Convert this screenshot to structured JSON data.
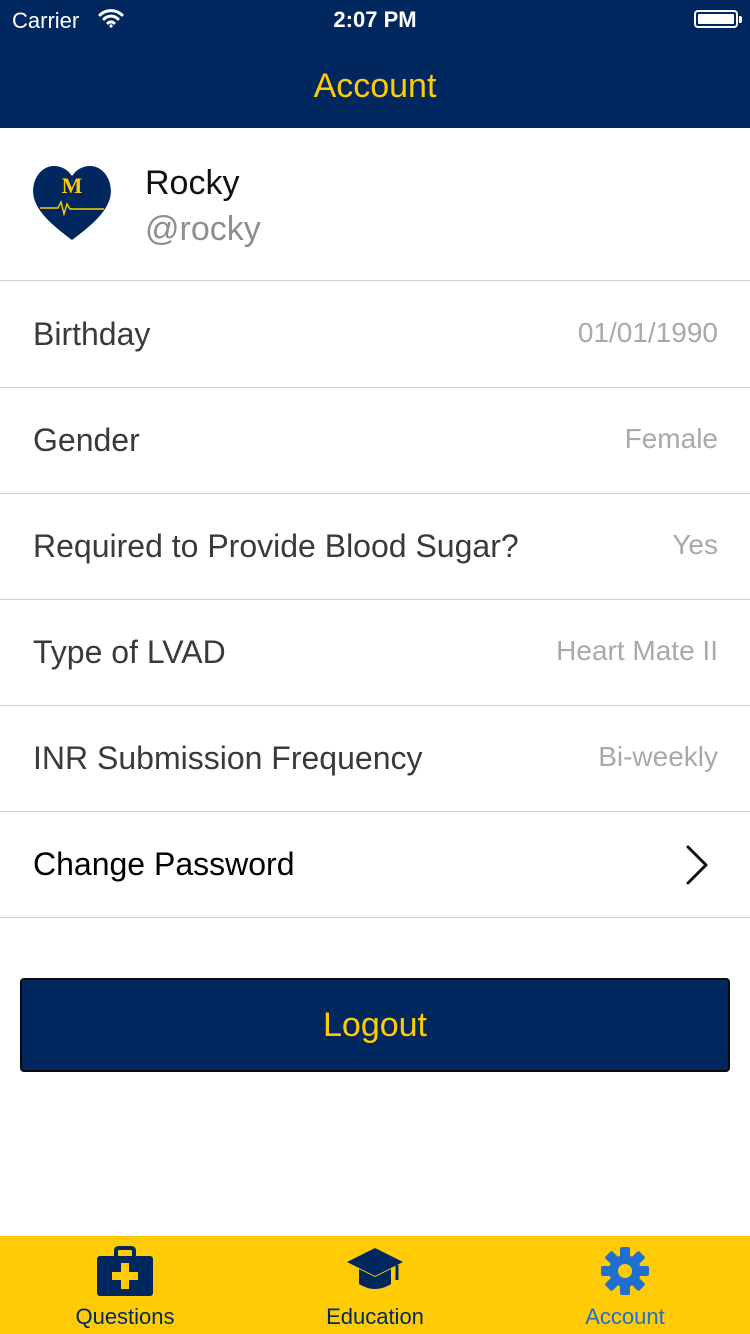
{
  "status_bar": {
    "carrier": "Carrier",
    "time": "2:07 PM"
  },
  "nav": {
    "title": "Account"
  },
  "profile": {
    "name": "Rocky",
    "handle": "@rocky",
    "avatar_letter": "M"
  },
  "rows": [
    {
      "label": "Birthday",
      "value": "01/01/1990"
    },
    {
      "label": "Gender",
      "value": "Female"
    },
    {
      "label": "Required to Provide Blood Sugar?",
      "value": "Yes"
    },
    {
      "label": "Type of LVAD",
      "value": "Heart Mate II"
    },
    {
      "label": "INR Submission Frequency",
      "value": "Bi-weekly"
    }
  ],
  "change_password": {
    "label": "Change Password"
  },
  "logout": {
    "label": "Logout"
  },
  "tabbar": {
    "items": [
      {
        "label": "Questions",
        "icon": "medical-kit-icon"
      },
      {
        "label": "Education",
        "icon": "graduation-cap-icon"
      },
      {
        "label": "Account",
        "icon": "gear-icon"
      }
    ],
    "active": "Account"
  },
  "colors": {
    "navy": "#00285e",
    "maize": "#ffcb05",
    "active_tab": "#1f6fd1"
  }
}
